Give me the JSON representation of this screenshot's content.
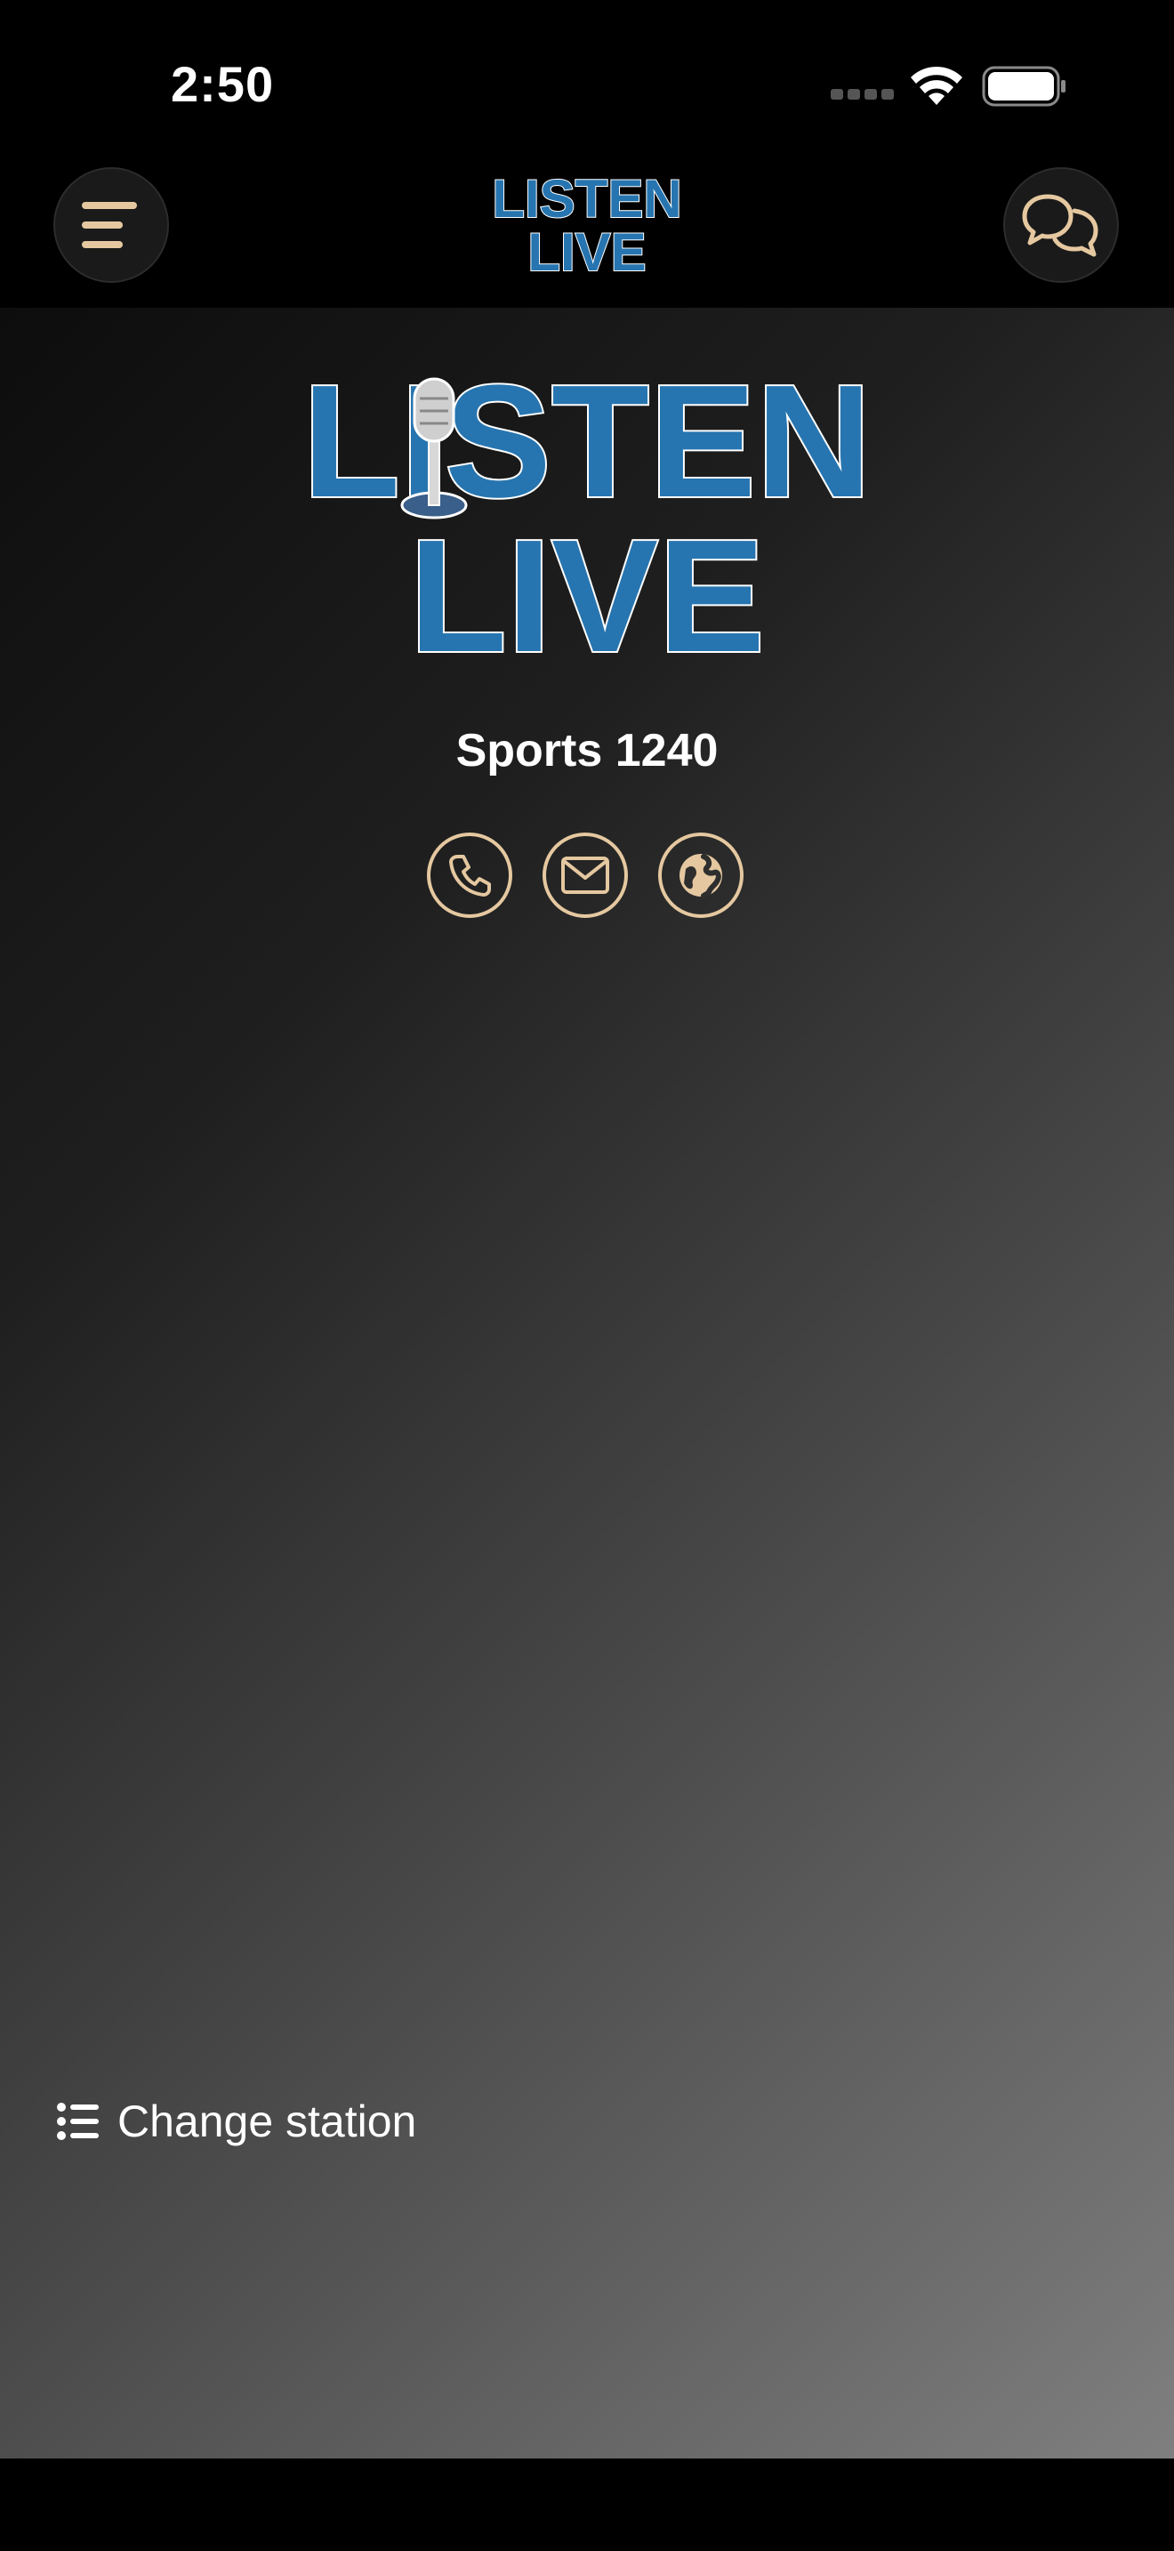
{
  "status_bar": {
    "time": "2:50"
  },
  "nav": {
    "logo_text_line1": "LISTEN",
    "logo_text_line2": "LIVE",
    "menu_icon": "menu-icon",
    "chat_icon": "chat-bubbles-icon"
  },
  "hero": {
    "logo_text_line1": "LISTEN",
    "logo_text_line2": "LIVE",
    "station_name": "Sports 1240"
  },
  "contact": {
    "items": [
      {
        "icon": "phone-icon"
      },
      {
        "icon": "email-icon"
      },
      {
        "icon": "globe-icon"
      }
    ]
  },
  "footer": {
    "change_station_label": "Change station",
    "change_station_icon": "list-icon"
  },
  "colors": {
    "accent": "#E5C8A0",
    "logo_blue": "#2775B0",
    "background": "#000000"
  }
}
